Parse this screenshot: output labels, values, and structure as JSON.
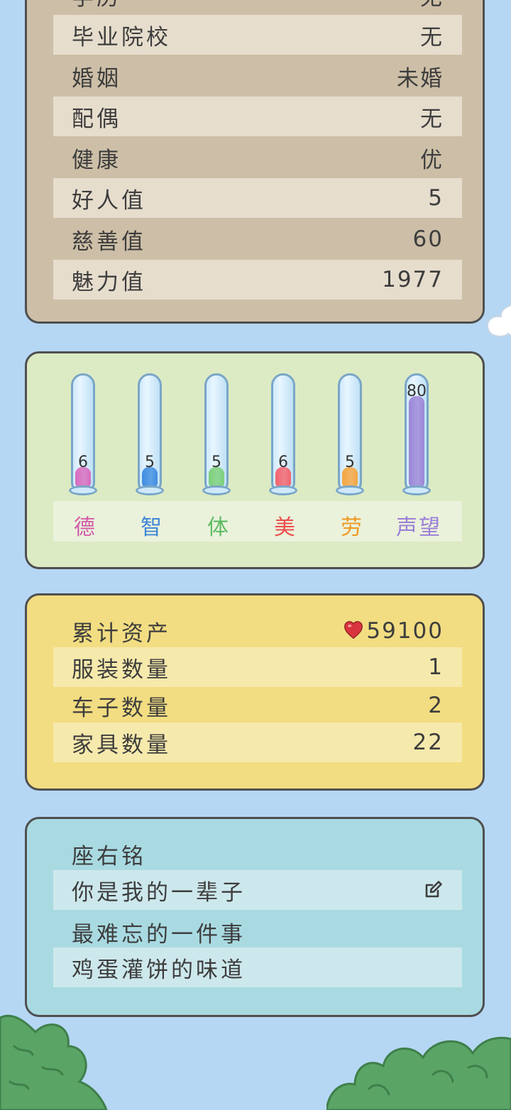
{
  "profile": {
    "rows": [
      {
        "label": "学历",
        "value": "无"
      },
      {
        "label": "毕业院校",
        "value": "无"
      },
      {
        "label": "婚姻",
        "value": "未婚"
      },
      {
        "label": "配偶",
        "value": "无"
      },
      {
        "label": "健康",
        "value": "优"
      },
      {
        "label": "好人值",
        "value": "5"
      },
      {
        "label": "慈善值",
        "value": "60"
      },
      {
        "label": "魅力值",
        "value": "1977"
      }
    ]
  },
  "attributes": {
    "items": [
      {
        "label": "德",
        "value": "6",
        "level": 0.06,
        "color": "#d86bbf",
        "label_color": "#d25aa9"
      },
      {
        "label": "智",
        "value": "5",
        "level": 0.05,
        "color": "#3f8ee0",
        "label_color": "#3f86d6"
      },
      {
        "label": "体",
        "value": "5",
        "level": 0.05,
        "color": "#7bd07a",
        "label_color": "#5dbb62"
      },
      {
        "label": "美",
        "value": "6",
        "level": 0.06,
        "color": "#f4646e",
        "label_color": "#ec4d4d"
      },
      {
        "label": "劳",
        "value": "5",
        "level": 0.05,
        "color": "#f5a640",
        "label_color": "#ef9a27"
      },
      {
        "label": "声望",
        "value": "80",
        "level": 0.8,
        "color": "#9c86d8",
        "label_color": "#9b7fd8"
      }
    ]
  },
  "assets": {
    "total_label": "累计资产",
    "total_value": "59100",
    "rows": [
      {
        "label": "服装数量",
        "value": "1"
      },
      {
        "label": "车子数量",
        "value": "2"
      },
      {
        "label": "家具数量",
        "value": "22"
      }
    ]
  },
  "motto": {
    "motto_label": "座右铭",
    "motto_value": "你是我的一辈子",
    "memory_label": "最难忘的一件事",
    "memory_value": "鸡蛋灌饼的味道"
  },
  "colors": {
    "background": "#b5d7f4",
    "heart": "#d9343e"
  }
}
